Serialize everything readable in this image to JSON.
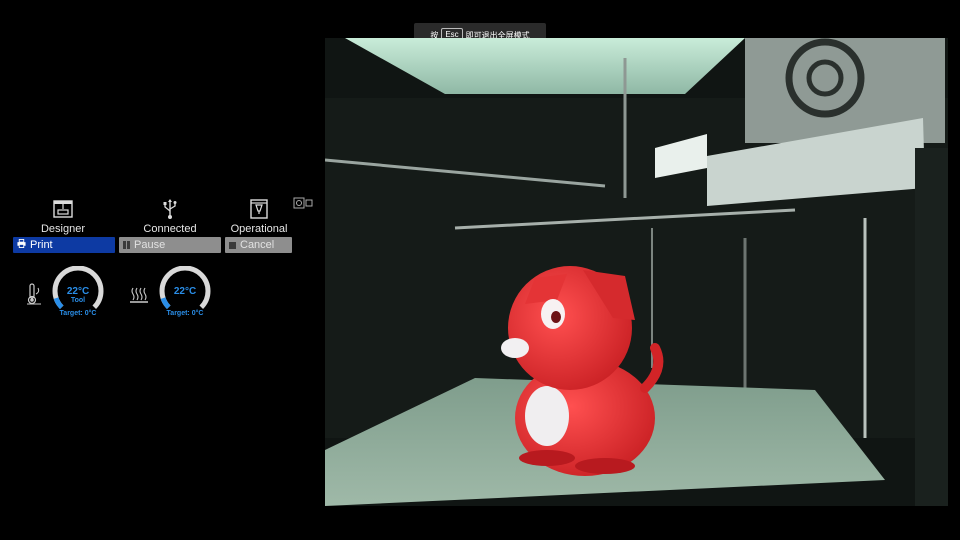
{
  "banner": {
    "pre": "按",
    "key": "Esc",
    "post": "即可退出全屏模式"
  },
  "status": {
    "designer": {
      "label": "Designer",
      "icon": "printer-icon"
    },
    "connection": {
      "label": "Connected",
      "icon": "usb-icon"
    },
    "state": {
      "label": "Operational",
      "icon": "nozzle-icon"
    },
    "camera_toggle_icon": "camera-toggle-icon"
  },
  "controls": {
    "print_label": "Print",
    "pause_label": "Pause",
    "cancel_label": "Cancel"
  },
  "gauges": {
    "tool": {
      "temp": "22°C",
      "sub": "Tool",
      "target": "Target: 0°C",
      "level": 0.1,
      "icon": "thermometer-icon"
    },
    "bed": {
      "temp": "22°C",
      "sub": "",
      "target": "Target: 0°C",
      "level": 0.1,
      "icon": "heated-bed-icon"
    }
  },
  "colors": {
    "accent": "#2a8ee8",
    "print_button": "#0d3aa3",
    "disabled_button": "#8e8e8e",
    "gauge_track": "#d9d9d9"
  },
  "camera": {
    "subject": "red-dog-print"
  }
}
